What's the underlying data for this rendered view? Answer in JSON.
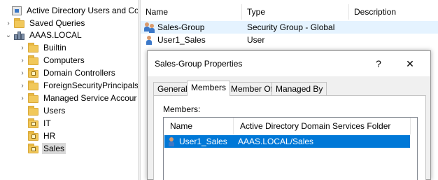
{
  "tree": {
    "root_label": "Active Directory Users and Com",
    "saved_queries": "Saved Queries",
    "domain": "AAAS.LOCAL",
    "items": [
      "Builtin",
      "Computers",
      "Domain Controllers",
      "ForeignSecurityPrincipals",
      "Managed Service Accour",
      "Users",
      "IT",
      "HR",
      "Sales"
    ],
    "selected": "Sales"
  },
  "list": {
    "columns": [
      "Name",
      "Type",
      "Description"
    ],
    "rows": [
      {
        "name": "Sales-Group",
        "type": "Security Group - Global",
        "icon": "group-icon"
      },
      {
        "name": "User1_Sales",
        "type": "User",
        "icon": "user-icon"
      }
    ]
  },
  "dialog": {
    "title": "Sales-Group Properties",
    "help_label": "?",
    "close_label": "✕",
    "tabs": [
      "General",
      "Members",
      "Member Of",
      "Managed By"
    ],
    "active_tab": "Members",
    "members_label": "Members:",
    "columns": [
      "Name",
      "Active Directory Domain Services Folder"
    ],
    "members": [
      {
        "name": "User1_Sales",
        "folder": "AAAS.LOCAL/Sales"
      }
    ]
  },
  "colors": {
    "selection": "#0078d7",
    "row_highlight": "#e5f3ff",
    "folder": "#f1c85b"
  }
}
